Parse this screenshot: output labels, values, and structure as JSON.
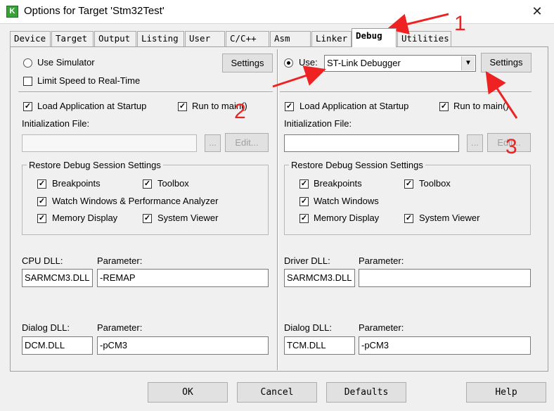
{
  "window": {
    "title": "Options for Target 'Stm32Test'",
    "app_icon": "keil-icon",
    "close_glyph": "✕"
  },
  "tabs": [
    {
      "label": "Device"
    },
    {
      "label": "Target"
    },
    {
      "label": "Output"
    },
    {
      "label": "Listing"
    },
    {
      "label": "User"
    },
    {
      "label": "C/C++"
    },
    {
      "label": "Asm"
    },
    {
      "label": "Linker"
    },
    {
      "label": "Debug",
      "active": true
    },
    {
      "label": "Utilities"
    }
  ],
  "left": {
    "use_simulator": "Use Simulator",
    "settings_label": "Settings",
    "limit_speed": "Limit Speed to Real-Time",
    "load_app": "Load Application at Startup",
    "run_to_main": "Run to main()",
    "init_file_label": "Initialization File:",
    "browse_label": "...",
    "edit_label": "Edit...",
    "restore_title": "Restore Debug Session Settings",
    "breakpoints": "Breakpoints",
    "toolbox": "Toolbox",
    "watch": "Watch Windows & Performance Analyzer",
    "memory": "Memory Display",
    "system_viewer": "System Viewer",
    "cpu_dll_label": "CPU DLL:",
    "cpu_param_label": "Parameter:",
    "cpu_dll_value": "SARMCM3.DLL",
    "cpu_param_value": "-REMAP",
    "dialog_dll_label": "Dialog DLL:",
    "dialog_param_label": "Parameter:",
    "dialog_dll_value": "DCM.DLL",
    "dialog_param_value": "-pCM3"
  },
  "right": {
    "use_label": "Use:",
    "debugger_value": "ST-Link Debugger",
    "settings_label": "Settings",
    "load_app": "Load Application at Startup",
    "run_to_main": "Run to main()",
    "init_file_label": "Initialization File:",
    "browse_label": "...",
    "edit_label": "Edit...",
    "restore_title": "Restore Debug Session Settings",
    "breakpoints": "Breakpoints",
    "toolbox": "Toolbox",
    "watch": "Watch Windows",
    "memory": "Memory Display",
    "system_viewer": "System Viewer",
    "driver_dll_label": "Driver DLL:",
    "driver_param_label": "Parameter:",
    "driver_dll_value": "SARMCM3.DLL",
    "driver_param_value": "",
    "dialog_dll_label": "Dialog DLL:",
    "dialog_param_label": "Parameter:",
    "dialog_dll_value": "TCM.DLL",
    "dialog_param_value": "-pCM3"
  },
  "buttons": {
    "ok": "OK",
    "cancel": "Cancel",
    "defaults": "Defaults",
    "help": "Help"
  },
  "annotations": {
    "n1": "1",
    "n2": "2",
    "n3": "3",
    "color": "#ee2222"
  },
  "check_glyph": "✓",
  "dropdown_glyph": "▼"
}
